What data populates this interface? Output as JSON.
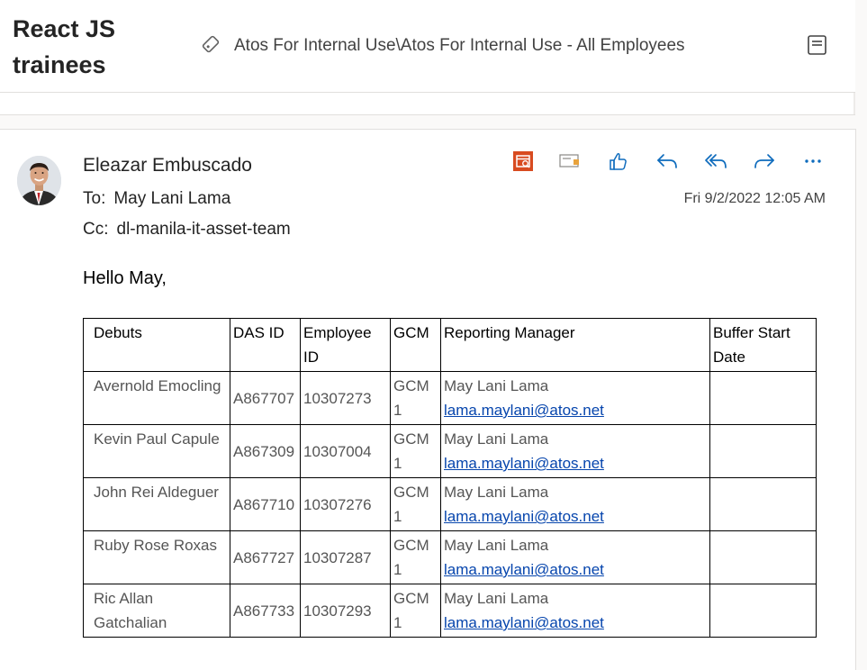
{
  "header": {
    "subject": "React JS trainees",
    "sensitivity_label": "Atos For Internal Use\\Atos For Internal Use - All Employees"
  },
  "message": {
    "from": "Eleazar Embuscado",
    "to_label": "To:",
    "to": "May Lani Lama",
    "cc_label": "Cc:",
    "cc": "dl-manila-it-asset-team",
    "date": "Fri 9/2/2022 12:05 AM",
    "greeting": "Hello May,"
  },
  "toolbar": {
    "icons": [
      "calendar-icon",
      "sensitivity-tag-icon",
      "like-icon",
      "reply-icon",
      "reply-all-icon",
      "forward-icon",
      "more-icon"
    ]
  },
  "table": {
    "headers": [
      "Debuts",
      "DAS ID",
      "Employee ID",
      "GCM",
      "Reporting Manager",
      "Buffer Start Date"
    ],
    "rows": [
      {
        "debut": "Avernold Emocling",
        "das_id": "A867707",
        "employee_id": "10307273",
        "gcm": "GCM 1",
        "manager": "May Lani Lama",
        "email": "lama.maylani@atos.net",
        "buffer_start": ""
      },
      {
        "debut": "Kevin Paul Capule",
        "das_id": "A867309",
        "employee_id": "10307004",
        "gcm": "GCM 1",
        "manager": "May Lani Lama",
        "email": "lama.maylani@atos.net",
        "buffer_start": ""
      },
      {
        "debut": "John Rei Aldeguer",
        "das_id": "A867710",
        "employee_id": "10307276",
        "gcm": "GCM 1",
        "manager": "May Lani Lama",
        "email": "lama.maylani@atos.net",
        "buffer_start": ""
      },
      {
        "debut": "Ruby Rose Roxas",
        "das_id": "A867727",
        "employee_id": "10307287",
        "gcm": "GCM 1",
        "manager": "May Lani Lama",
        "email": "lama.maylani@atos.net",
        "buffer_start": ""
      },
      {
        "debut": "Ric Allan Gatchalian",
        "das_id": "A867733",
        "employee_id": "10307293",
        "gcm": "GCM 1",
        "manager": "May Lani Lama",
        "email": "lama.maylani@atos.net",
        "buffer_start": ""
      }
    ]
  },
  "colors": {
    "accent": "#0f6cbd",
    "calendar_icon": "#d84b20",
    "link": "#0645ad"
  }
}
